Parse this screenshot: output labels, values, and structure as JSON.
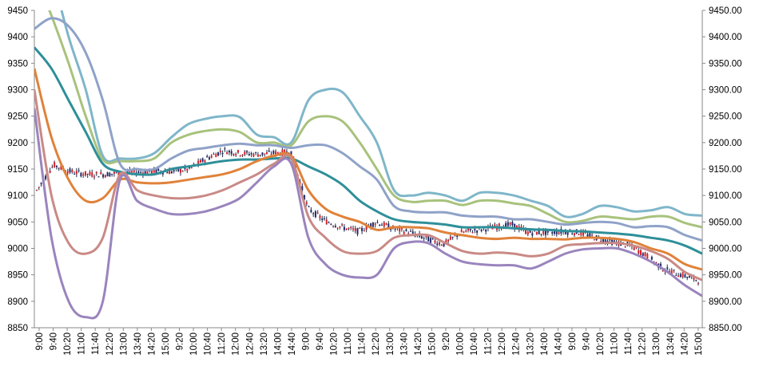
{
  "chart_data": {
    "type": "line",
    "ylim": [
      8850,
      9450
    ],
    "y_ticks_left": [
      "9450",
      "9400",
      "9350",
      "9300",
      "9250",
      "9200",
      "9150",
      "9100",
      "9050",
      "9000",
      "8950",
      "8900",
      "8850"
    ],
    "y_ticks_right": [
      "9450.00",
      "9400.00",
      "9350.00",
      "9300.00",
      "9250.00",
      "9200.00",
      "9150.00",
      "9100.00",
      "9050.00",
      "9000.00",
      "8950.00",
      "8900.00",
      "8850.00"
    ],
    "x_tick_labels": [
      "9:00",
      "9:40",
      "10:20",
      "11:00",
      "11:40",
      "12:20",
      "13:00",
      "13:40",
      "14:20",
      "15:00",
      "9:20",
      "10:00",
      "10:40",
      "11:20",
      "12:00",
      "12:40",
      "13:20",
      "14:00",
      "14:40",
      "9:00",
      "9:40",
      "10:20",
      "11:00",
      "11:40",
      "12:20",
      "13:00",
      "13:40",
      "14:20",
      "15:00",
      "9:20",
      "10:00",
      "10:40",
      "11:20",
      "12:00",
      "12:40",
      "13:20",
      "14:00",
      "14:40",
      "9:00",
      "9:40",
      "10:20",
      "11:00",
      "11:40",
      "12:20",
      "13:00",
      "13:40",
      "14:20",
      "15:00"
    ],
    "grid": false,
    "legend": "none",
    "series": [
      {
        "color": "#7fb6c9",
        "values": [
          9600,
          9520,
          9400,
          9300,
          9175,
          9170,
          9170,
          9180,
          9210,
          9235,
          9245,
          9250,
          9248,
          9215,
          9210,
          9200,
          9280,
          9300,
          9295,
          9250,
          9200,
          9110,
          9100,
          9105,
          9100,
          9090,
          9105,
          9105,
          9100,
          9090,
          9080,
          9060,
          9065,
          9080,
          9078,
          9070,
          9072,
          9078,
          9065,
          9062
        ]
      },
      {
        "color": "#a8c27c",
        "values": [
          9520,
          9440,
          9350,
          9250,
          9168,
          9165,
          9165,
          9170,
          9200,
          9215,
          9222,
          9225,
          9220,
          9200,
          9200,
          9195,
          9240,
          9250,
          9240,
          9200,
          9150,
          9100,
          9088,
          9090,
          9090,
          9082,
          9090,
          9090,
          9085,
          9080,
          9065,
          9050,
          9052,
          9060,
          9058,
          9055,
          9060,
          9060,
          9048,
          9040
        ]
      },
      {
        "color": "#8fa2c8",
        "values": [
          9415,
          9435,
          9420,
          9370,
          9280,
          9160,
          9150,
          9150,
          9170,
          9185,
          9190,
          9195,
          9198,
          9195,
          9195,
          9190,
          9195,
          9195,
          9180,
          9155,
          9130,
          9080,
          9070,
          9068,
          9068,
          9062,
          9060,
          9060,
          9055,
          9055,
          9050,
          9045,
          9048,
          9050,
          9048,
          9040,
          9042,
          9040,
          9025,
          9015
        ]
      },
      {
        "color": "#2e8f99",
        "values": [
          9380,
          9340,
          9280,
          9220,
          9160,
          9145,
          9140,
          9140,
          9150,
          9155,
          9160,
          9165,
          9168,
          9168,
          9170,
          9170,
          9155,
          9140,
          9120,
          9090,
          9070,
          9055,
          9050,
          9048,
          9045,
          9040,
          9040,
          9040,
          9038,
          9036,
          9035,
          9033,
          9032,
          9030,
          9028,
          9025,
          9020,
          9015,
          9005,
          8990
        ]
      },
      {
        "color": "#e0823a",
        "values": [
          9340,
          9210,
          9130,
          9090,
          9095,
          9130,
          9125,
          9123,
          9125,
          9130,
          9135,
          9140,
          9150,
          9165,
          9175,
          9175,
          9110,
          9075,
          9060,
          9050,
          9035,
          9040,
          9040,
          9038,
          9030,
          9025,
          9020,
          9018,
          9020,
          9018,
          9018,
          9017,
          9020,
          9020,
          9018,
          9012,
          9000,
          8990,
          8970,
          8960
        ]
      },
      {
        "color": "#c98a86",
        "values": [
          9300,
          9100,
          9010,
          8990,
          9020,
          9140,
          9110,
          9100,
          9095,
          9095,
          9100,
          9110,
          9125,
          9140,
          9160,
          9170,
          9060,
          9020,
          8995,
          8990,
          8995,
          9020,
          9025,
          9025,
          9010,
          8995,
          8990,
          8992,
          8990,
          8985,
          8990,
          9005,
          9008,
          9010,
          9010,
          9005,
          8995,
          8980,
          8955,
          8940
        ]
      },
      {
        "color": "#9a84bd",
        "values": [
          9265,
          9020,
          8900,
          8870,
          8900,
          9130,
          9090,
          9075,
          9065,
          9065,
          9070,
          9080,
          9095,
          9125,
          9155,
          9160,
          9020,
          8970,
          8950,
          8945,
          8950,
          9000,
          9012,
          9010,
          8990,
          8975,
          8970,
          8968,
          8968,
          8962,
          8975,
          8990,
          8998,
          9000,
          9000,
          8990,
          8975,
          8955,
          8930,
          8910
        ]
      }
    ],
    "price_path": [
      9110,
      9158,
      9145,
      9140,
      9140,
      9143,
      9144,
      9146,
      9145,
      9150,
      9170,
      9185,
      9180,
      9178,
      9180,
      9182,
      9075,
      9052,
      9040,
      9032,
      9050,
      9038,
      9030,
      9018,
      9008,
      9030,
      9035,
      9040,
      9045,
      9030,
      9030,
      9032,
      9030,
      9020,
      9012,
      9005,
      8985,
      8960,
      8950,
      8940
    ]
  }
}
